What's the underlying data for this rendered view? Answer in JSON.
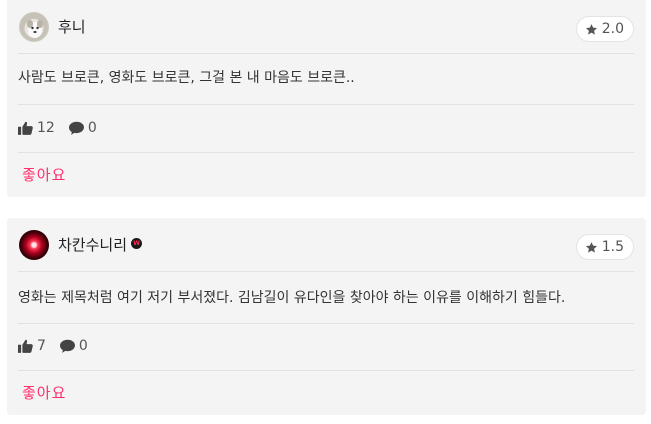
{
  "reviews": [
    {
      "username": "후니",
      "rating": "2.0",
      "comment": "사람도 브로큰, 영화도 브로큰, 그걸 본 내 마음도 브로큰..",
      "likes": "12",
      "comments": "0",
      "like_label": "좋아요"
    },
    {
      "username": "차칸수니리",
      "badge": "W",
      "rating": "1.5",
      "comment": "영화는 제목처럼 여기 저기 부서졌다. 김남길이 유다인을 찾아야 하는 이유를 이해하기 힘들다.",
      "likes": "7",
      "comments": "0",
      "like_label": "좋아요"
    }
  ],
  "colors": {
    "accent": "#ff2f6e",
    "card_bg": "#f4f4f4"
  },
  "icons": {
    "rating": "star-icon",
    "likes": "thumbs-up-icon",
    "comments": "speech-bubble-icon"
  }
}
